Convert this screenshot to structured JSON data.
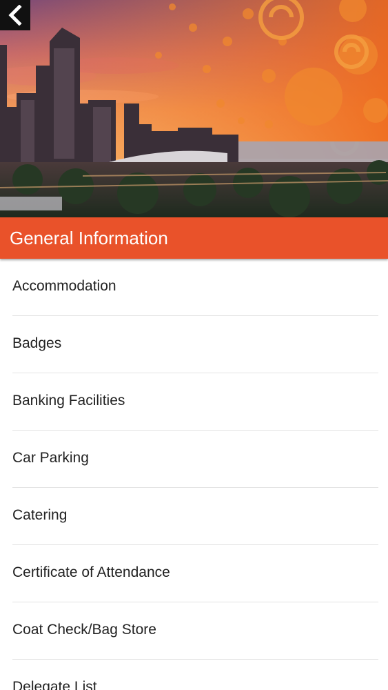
{
  "header": {
    "back_icon": "chevron-left-icon",
    "title": "General Information"
  },
  "colors": {
    "accent": "#e9522a",
    "back_button_bg": "#111111",
    "divider": "#e3e3e3",
    "text": "#222222"
  },
  "list": {
    "items": [
      {
        "label": "Accommodation"
      },
      {
        "label": "Badges"
      },
      {
        "label": "Banking Facilities"
      },
      {
        "label": "Car Parking"
      },
      {
        "label": "Catering"
      },
      {
        "label": "Certificate of Attendance"
      },
      {
        "label": "Coat Check/Bag Store"
      },
      {
        "label": "Delegate List"
      }
    ]
  }
}
